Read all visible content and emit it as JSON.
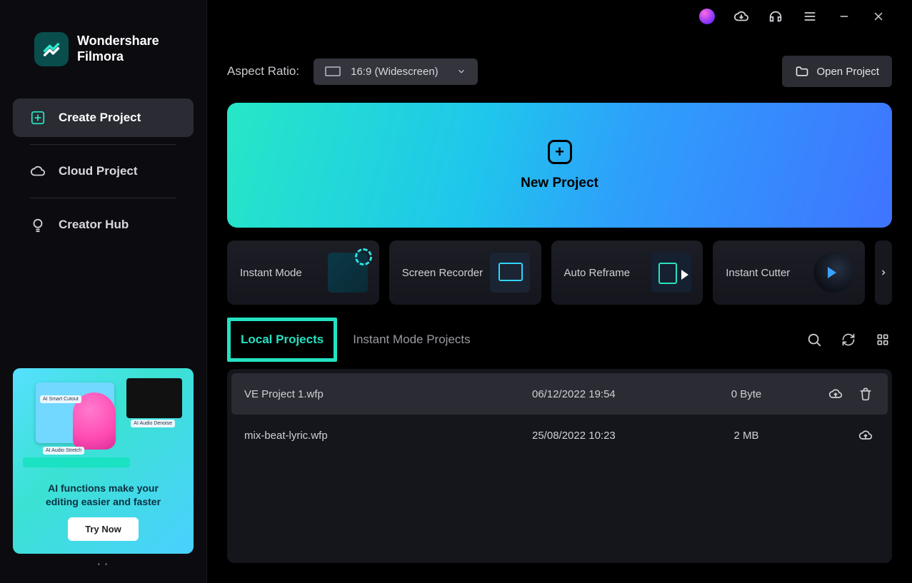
{
  "brand": {
    "line1": "Wondershare",
    "line2": "Filmora"
  },
  "sidebar": {
    "items": [
      {
        "label": "Create Project"
      },
      {
        "label": "Cloud Project"
      },
      {
        "label": "Creator Hub"
      }
    ]
  },
  "promo": {
    "scene_labels": {
      "a": "AI Smart Cutout",
      "b": "AI Audio Denoise",
      "c": "AI Audio Stretch"
    },
    "text_line1": "AI functions make your",
    "text_line2": "editing easier and faster",
    "cta": "Try Now"
  },
  "toolbar": {
    "aspect_label": "Aspect Ratio:",
    "aspect_value": "16:9 (Widescreen)",
    "open_label": "Open Project"
  },
  "hero": {
    "label": "New Project"
  },
  "modes": [
    {
      "label": "Instant Mode"
    },
    {
      "label": "Screen Recorder"
    },
    {
      "label": "Auto Reframe"
    },
    {
      "label": "Instant Cutter"
    }
  ],
  "tabs": {
    "local": "Local Projects",
    "instant": "Instant Mode Projects"
  },
  "projects": [
    {
      "name": "VE Project 1.wfp",
      "date": "06/12/2022 19:54",
      "size": "0 Byte",
      "active": true
    },
    {
      "name": "mix-beat-lyric.wfp",
      "date": "25/08/2022 10:23",
      "size": "2 MB",
      "active": false
    }
  ]
}
